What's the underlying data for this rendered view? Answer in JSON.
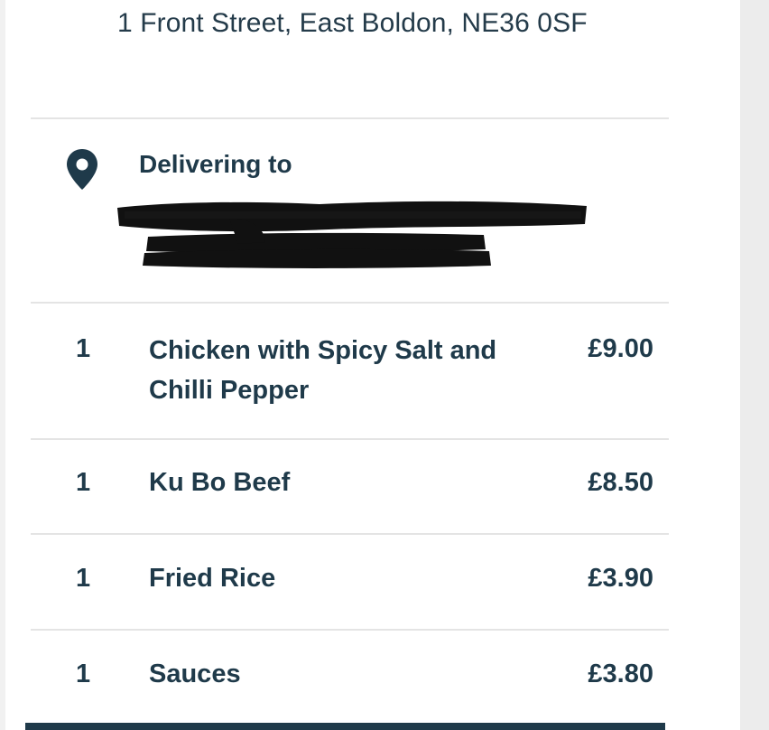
{
  "restaurant": {
    "address": "1 Front Street, East Boldon, NE36 0SF"
  },
  "delivery": {
    "icon": "location-pin-icon",
    "label": "Delivering to"
  },
  "order": {
    "items": [
      {
        "qty": "1",
        "name": "Chicken with Spicy Salt and Chilli Pepper",
        "price": "£9.00"
      },
      {
        "qty": "1",
        "name": "Ku Bo Beef",
        "price": "£8.50"
      },
      {
        "qty": "1",
        "name": "Fried Rice",
        "price": "£3.90"
      },
      {
        "qty": "1",
        "name": "Sauces",
        "price": "£3.80"
      }
    ]
  },
  "colors": {
    "text": "#1f3a4a",
    "divider": "#e4e4e4",
    "background": "#ffffff",
    "gutter": "#ededed"
  }
}
